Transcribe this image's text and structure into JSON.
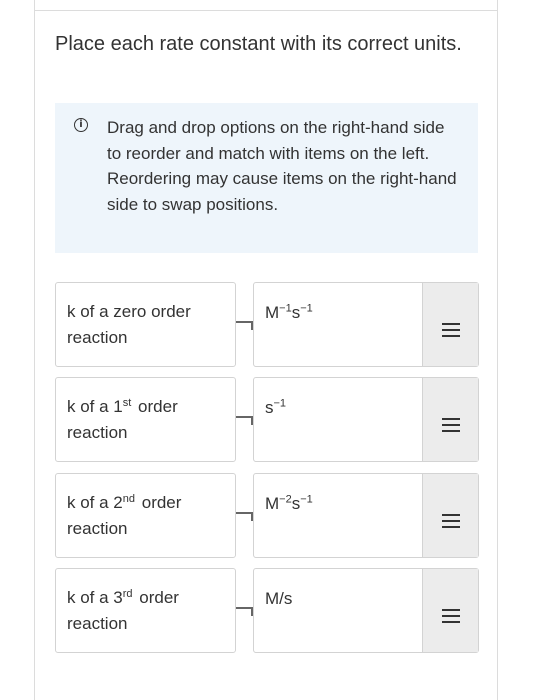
{
  "question": {
    "text": "Place each rate constant with its correct units."
  },
  "info_box": {
    "icon": "info-icon",
    "line1": "Drag and drop options on the right-hand side to reorder and match with items on the left.",
    "line2": "Reordering may cause items on the right-hand side to swap positions."
  },
  "rows": [
    {
      "left": {
        "prefix": "k of a zero order",
        "sup": "",
        "suffix": "",
        "second_line": "reaction"
      },
      "right": {
        "base1": "M",
        "exp1": "−1",
        "base2": "s",
        "exp2": "−1"
      }
    },
    {
      "left": {
        "prefix": "k of a 1",
        "sup": "st",
        "suffix": "order",
        "second_line": "reaction"
      },
      "right": {
        "base1": "s",
        "exp1": "−1",
        "base2": "",
        "exp2": ""
      }
    },
    {
      "left": {
        "prefix": "k of a 2",
        "sup": "nd",
        "suffix": "order",
        "second_line": "reaction"
      },
      "right": {
        "base1": "M",
        "exp1": "−2",
        "base2": "s",
        "exp2": "−1"
      }
    },
    {
      "left": {
        "prefix": "k of a 3",
        "sup": "rd",
        "suffix": "order",
        "second_line": "reaction"
      },
      "right": {
        "base1": "M/s",
        "exp1": "",
        "base2": "",
        "exp2": ""
      }
    }
  ],
  "colors": {
    "info_background": "#eef5fb",
    "border": "#d3d3d3",
    "handle_background": "#ececec",
    "text": "#333333"
  }
}
